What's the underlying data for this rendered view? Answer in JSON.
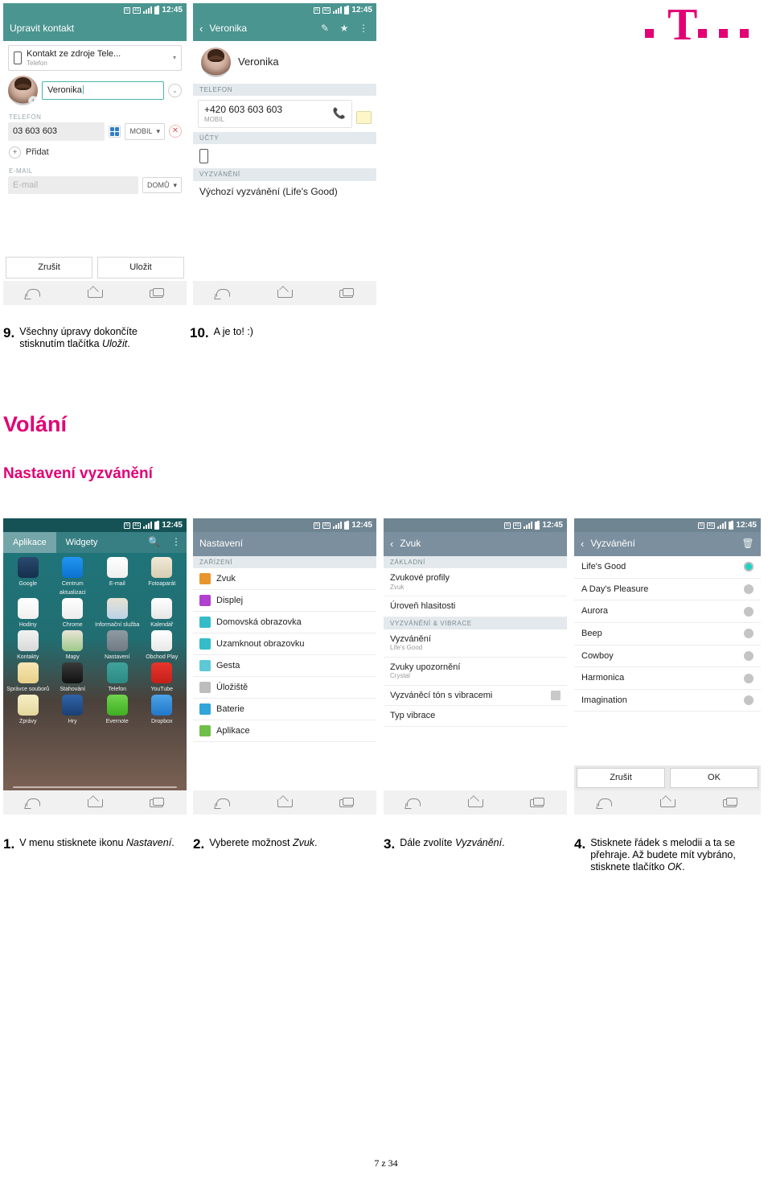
{
  "logo": {
    "letter": "T",
    "name": "t-mobile-logo"
  },
  "page_number": "7 z 34",
  "headings": {
    "main": "Volání",
    "sub": "Nastavení vyzvánění"
  },
  "captions_row1": [
    {
      "num": "9.",
      "text": "Všechny úpravy dokončíte stisknutím tlačítka ",
      "em": "Uložit",
      "tail": "."
    },
    {
      "num": "10.",
      "text": "A je to! :)",
      "em": "",
      "tail": ""
    }
  ],
  "captions_row2": [
    {
      "num": "1.",
      "text": "V menu stisknete ikonu ",
      "em": "Nastavení",
      "tail": "."
    },
    {
      "num": "2.",
      "text": "Vyberete možnost ",
      "em": "Zvuk",
      "tail": "."
    },
    {
      "num": "3.",
      "text": "Dále zvolíte ",
      "em": "Vyzvánění",
      "tail": "."
    },
    {
      "num": "4.",
      "text": "Stisknete řádek s melodii a ta se přehraje. Až budete mít vybráno, stisknete tlačítko ",
      "em": "OK",
      "tail": "."
    }
  ],
  "status_bar": {
    "time": "12:45",
    "nfc": "N",
    "lte": "4G",
    "signal_icon": "signal-bars-icon",
    "battery_icon": "battery-icon"
  },
  "phone_edit_contact": {
    "app_title": "Upravit kontakt",
    "source": {
      "line1": "Kontakt ze zdroje Tele...",
      "line2": "Telefon"
    },
    "name_value": "Veronika",
    "section_phone": "TELEFON",
    "phone_value": "03 603 603",
    "phone_type": "MOBIL",
    "add_label": "Přidat",
    "section_email": "E-MAIL",
    "email_placeholder": "E-mail",
    "email_type": "DOMŮ",
    "cancel": "Zrušit",
    "save": "Uložit"
  },
  "phone_contact_detail": {
    "app_title": "Veronika",
    "icons": [
      "edit-pencil-icon",
      "star-icon",
      "overflow-menu-icon"
    ],
    "contact_name": "Veronika",
    "section_phone": "TELEFON",
    "phone_number": "+420 603 603 603",
    "phone_type": "MOBIL",
    "section_accounts": "ÚČTY",
    "section_ringtone": "VYZVÁNĚNÍ",
    "ringtone_value": "Výchozí vyzvánění (Life's Good)"
  },
  "phone_apps": {
    "tab_apps": "Aplikace",
    "tab_widgets": "Widgety",
    "search_icon": "search-icon",
    "menu_icon": "overflow-menu-icon",
    "apps": [
      {
        "label": "Google",
        "icon": "google-folder-icon",
        "c1": "#2b4a6f",
        "c2": "#14304d"
      },
      {
        "label": "Centrum aktualizaci",
        "icon": "update-center-icon",
        "c1": "#2196f3",
        "c2": "#0b72cf"
      },
      {
        "label": "E-mail",
        "icon": "email-icon",
        "c1": "#ffffff",
        "c2": "#efefef"
      },
      {
        "label": "Fotoaparát",
        "icon": "camera-icon",
        "c1": "#f2ead8",
        "c2": "#d8cdb3"
      },
      {
        "label": "Hodiny",
        "icon": "clock-icon",
        "c1": "#ffffff",
        "c2": "#f0f0f0"
      },
      {
        "label": "Chrome",
        "icon": "chrome-icon",
        "c1": "#ffffff",
        "c2": "#ededed"
      },
      {
        "label": "Informační služba",
        "icon": "news-maps-icon",
        "c1": "#e8e2d2",
        "c2": "#bcd2e8"
      },
      {
        "label": "Kalendář",
        "icon": "calendar-icon",
        "c1": "#ffffff",
        "c2": "#e6e6e6"
      },
      {
        "label": "Kontakty",
        "icon": "contacts-icon",
        "c1": "#f2f2f2",
        "c2": "#d9d9d9"
      },
      {
        "label": "Mapy",
        "icon": "maps-icon",
        "c1": "#e9e4d6",
        "c2": "#9ec98a"
      },
      {
        "label": "Nastavení",
        "icon": "settings-gear-icon",
        "c1": "#8f9aa3",
        "c2": "#6f7a83"
      },
      {
        "label": "Obchod Play",
        "icon": "play-store-icon",
        "c1": "#ffffff",
        "c2": "#e8e8e8"
      },
      {
        "label": "Správce souborů",
        "icon": "file-manager-icon",
        "c1": "#f7e6b5",
        "c2": "#e8d089"
      },
      {
        "label": "Stahování",
        "icon": "downloads-icon",
        "c1": "#3a3a3a",
        "c2": "#111111"
      },
      {
        "label": "Telefon",
        "icon": "phone-icon",
        "c1": "#3fa39b",
        "c2": "#2d8a84"
      },
      {
        "label": "YouTube",
        "icon": "youtube-icon",
        "c1": "#e8352c",
        "c2": "#c5201a"
      },
      {
        "label": "Zprávy",
        "icon": "messages-icon",
        "c1": "#f6eec6",
        "c2": "#e4d79c"
      },
      {
        "label": "Hry",
        "icon": "games-icon",
        "c1": "#2f64a8",
        "c2": "#1b3f73"
      },
      {
        "label": "Evernote",
        "icon": "evernote-icon",
        "c1": "#6fd44c",
        "c2": "#3fae22"
      },
      {
        "label": "Dropbox",
        "icon": "dropbox-icon",
        "c1": "#4ba3e8",
        "c2": "#2277c9"
      }
    ]
  },
  "phone_settings": {
    "app_title": "Nastavení",
    "section": "ZAŘÍZENÍ",
    "items": [
      {
        "label": "Zvuk",
        "icon": "sound-icon",
        "color": "#e8962c"
      },
      {
        "label": "Displej",
        "icon": "display-icon",
        "color": "#b040d0"
      },
      {
        "label": "Domovská obrazovka",
        "icon": "home-screen-icon",
        "color": "#35bcc8"
      },
      {
        "label": "Uzamknout obrazovku",
        "icon": "lock-screen-icon",
        "color": "#35bcc8"
      },
      {
        "label": "Gesta",
        "icon": "gestures-icon",
        "color": "#5ec9d6"
      },
      {
        "label": "Úložiště",
        "icon": "storage-icon",
        "color": "#bdbdbd"
      },
      {
        "label": "Baterie",
        "icon": "battery-icon",
        "color": "#2fa5d8"
      },
      {
        "label": "Aplikace",
        "icon": "apps-icon",
        "color": "#6fbf4a"
      }
    ]
  },
  "phone_sound": {
    "app_title": "Zvuk",
    "section_basic": "ZÁKLADNÍ",
    "section_ring": "VYZVÁNĚNÍ & VIBRACE",
    "items": [
      {
        "title": "Zvukové profily",
        "sub": "Zvuk",
        "toggle": false
      },
      {
        "title": "Úroveň hlasitosti",
        "sub": "",
        "toggle": false
      },
      {
        "title": "Vyzvánění",
        "sub": "Life's Good",
        "toggle": false
      },
      {
        "title": "Zvuky upozornění",
        "sub": "Crystal",
        "toggle": false
      },
      {
        "title": "Vyzváněcí tón s vibracemi",
        "sub": "",
        "toggle": true
      },
      {
        "title": "Typ vibrace",
        "sub": "",
        "toggle": false
      }
    ]
  },
  "phone_ringtone": {
    "app_title": "Vyzvánění",
    "delete_icon": "trash-icon",
    "items": [
      {
        "label": "Life's Good",
        "selected": true
      },
      {
        "label": "A Day's Pleasure",
        "selected": false
      },
      {
        "label": "Aurora",
        "selected": false
      },
      {
        "label": "Beep",
        "selected": false
      },
      {
        "label": "Cowboy",
        "selected": false
      },
      {
        "label": "Harmonica",
        "selected": false
      },
      {
        "label": "Imagination",
        "selected": false
      }
    ],
    "cancel": "Zrušit",
    "ok": "OK"
  },
  "colors": {
    "magenta": "#e20074",
    "teal_header": "#4a9590",
    "settings_header": "#7b8f9e",
    "accent_cyan": "#19d3c5"
  }
}
